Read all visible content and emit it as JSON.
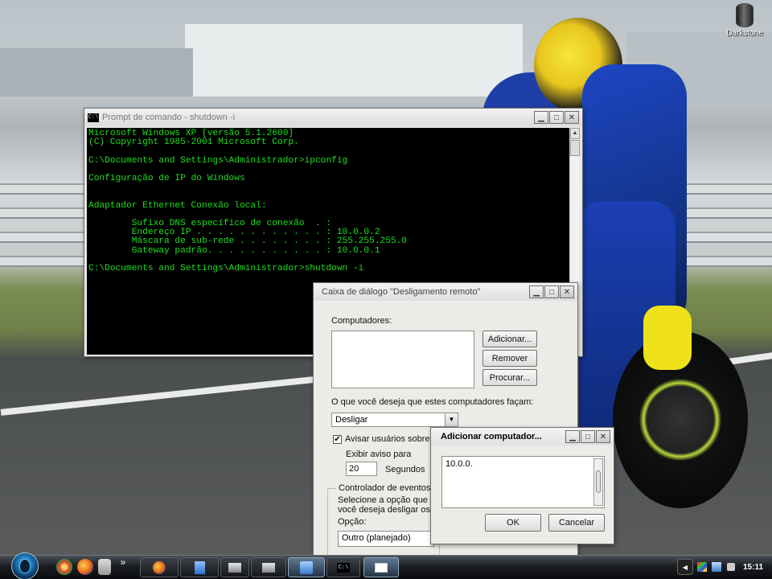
{
  "desktop": {
    "icons": [
      {
        "label": "Darkstone"
      }
    ]
  },
  "cmd_window": {
    "title": "Prompt de comando - shutdown -i",
    "icon_text": "C:\\",
    "lines": [
      "Microsoft Windows XP [versão 5.1.2600]",
      "(C) Copyright 1985-2001 Microsoft Corp.",
      "",
      "C:\\Documents and Settings\\Administrador>ipconfig",
      "",
      "Configuração de IP do Windows",
      "",
      "",
      "Adaptador Ethernet Conexão local:",
      "",
      "        Sufixo DNS específico de conexão  . :",
      "        Endereço IP . . . . . . . . . . . . : 10.0.0.2",
      "        Máscara de sub-rede . . . . . . . . : 255.255.255.0",
      "        Gateway padrão. . . . . . . . . . . : 10.0.0.1",
      "",
      "C:\\Documents and Settings\\Administrador>shutdown -i"
    ]
  },
  "remote_shutdown_dialog": {
    "title": "Caixa de diálogo \"Desligamento remoto\"",
    "computers_label": "Computadores:",
    "add_button": "Adicionar...",
    "remove_button": "Remover",
    "browse_button": "Procurar...",
    "action_label": "O que você deseja que estes computadores façam:",
    "action_value": "Desligar",
    "warn_users_label": "Avisar usuários sobre a",
    "warn_checked": true,
    "show_warning_label": "Exibir aviso para",
    "seconds_value": "20",
    "seconds_label": "Segundos",
    "event_tracker_label": "Controlador de eventos d",
    "event_desc_line1": "Selecione a opção que m",
    "event_desc_line2": "você deseja desligar os c",
    "option_label": "Opção:",
    "option_value": "Outro (planejado)"
  },
  "add_computer_dialog": {
    "title": "Adicionar computador...",
    "input_value": "10.0.0.",
    "ok_button": "OK",
    "cancel_button": "Cancelar"
  },
  "taskbar": {
    "cmd_task_icon": "C:\\",
    "quicklaunch_overflow": "»",
    "clock": "15:11"
  },
  "colors": {
    "console_text": "#1ce01c",
    "console_bg": "#000000",
    "dialog_bg": "#ecebe6"
  }
}
